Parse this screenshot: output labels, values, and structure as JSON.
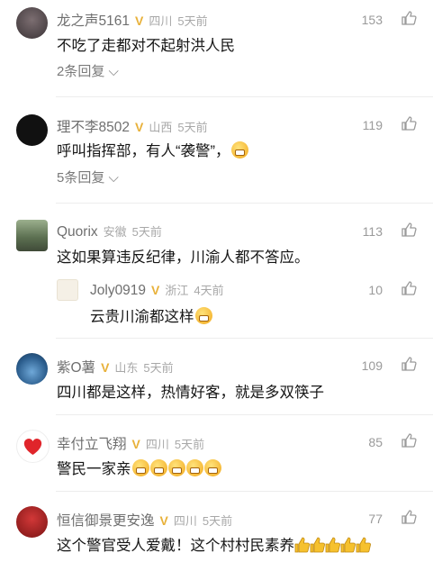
{
  "comments": [
    {
      "user": "龙之声5161",
      "badge": "V",
      "location": "四川",
      "time": "5天前",
      "likes": "153",
      "text": "不吃了走都对不起射洪人民",
      "replies": "2条回复"
    },
    {
      "user": "理不李8502",
      "badge": "V",
      "location": "山西",
      "time": "5天前",
      "likes": "119",
      "text": "呼叫指挥部，有人“袭警”，",
      "replies": "5条回复"
    },
    {
      "user": "Quorix",
      "location": "安徽",
      "time": "5天前",
      "likes": "113",
      "text": "这如果算违反纪律，川渝人都不答应。"
    },
    {
      "user": "Joly0919",
      "badge": "V",
      "location": "浙江",
      "time": "4天前",
      "likes": "10",
      "text": "云贵川渝都这样"
    },
    {
      "user": "紫O薯",
      "badge": "V",
      "location": "山东",
      "time": "5天前",
      "likes": "109",
      "text": "四川都是这样，热情好客，就是多双筷子"
    },
    {
      "user": "幸付立飞翔",
      "badge": "V",
      "location": "四川",
      "time": "5天前",
      "likes": "85",
      "text": "警民一家亲"
    },
    {
      "user": "恒信御景更安逸",
      "badge": "V",
      "location": "四川",
      "time": "5天前",
      "likes": "77",
      "text": "这个警官受人爱戴！这个村村民素养"
    }
  ],
  "icons": {
    "badge": "vip-badge-icon",
    "like": "thumb-like-icon",
    "emoji_grin": "grin-emoji",
    "emoji_thumb": "thumbs-up-emoji",
    "chevron": "chevron-down-icon"
  },
  "colors": {
    "accent": "#e8b13a",
    "meta": "#a8a8a8",
    "text": "#161616"
  }
}
